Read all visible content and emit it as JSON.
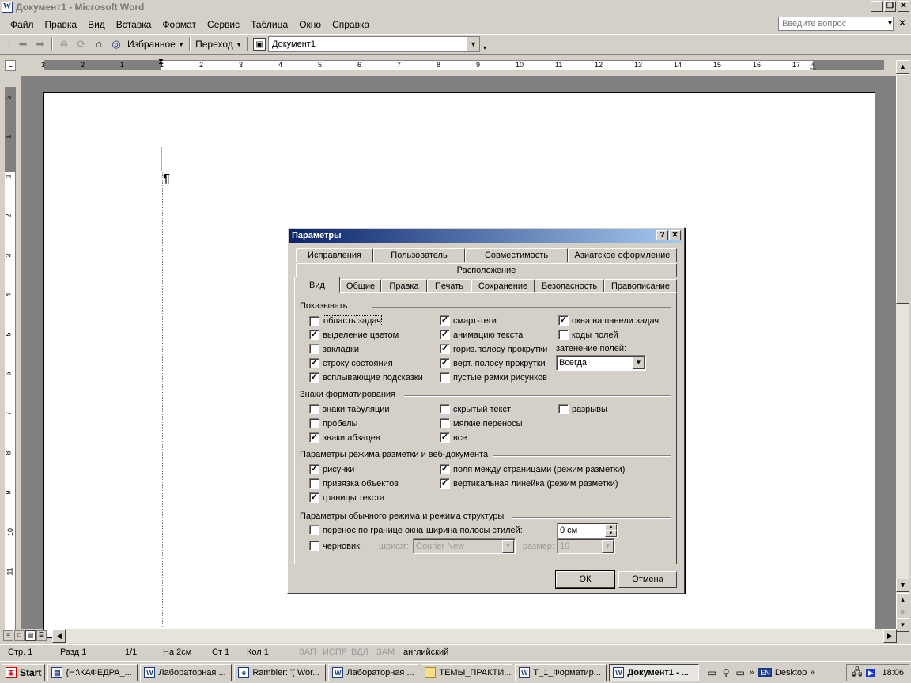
{
  "window": {
    "title": "Документ1 - Microsoft Word",
    "min": "_",
    "restore": "❐",
    "close": "✕"
  },
  "menu": {
    "items": [
      "Файл",
      "Правка",
      "Вид",
      "Вставка",
      "Формат",
      "Сервис",
      "Таблица",
      "Окно",
      "Справка"
    ],
    "ask_placeholder": "Введите вопрос",
    "close": "✕"
  },
  "toolbar": {
    "favorites": "Избранное",
    "go": "Переход",
    "address": "Документ1"
  },
  "ruler": {
    "h_numbers": [
      "3",
      "2",
      "1",
      "1",
      "2",
      "3",
      "4",
      "5",
      "6",
      "7",
      "8",
      "9",
      "10",
      "11",
      "12",
      "13",
      "14",
      "15",
      "16",
      "17"
    ],
    "v_numbers": [
      "2",
      "1",
      "1",
      "2",
      "3",
      "4",
      "5",
      "6",
      "7",
      "8",
      "9",
      "10",
      "11"
    ],
    "corner": "L"
  },
  "document": {
    "paragraph_mark": "¶"
  },
  "status": {
    "page": "Стр. 1",
    "section": "Разд 1",
    "pages": "1/1",
    "at": "На 2см",
    "line": "Ст 1",
    "col": "Кол 1",
    "rec": "ЗАП",
    "trk": "ИСПР",
    "ext": "ВДЛ",
    "ovr": "ЗАМ",
    "lang": "английский"
  },
  "taskbar": {
    "start": "Start",
    "tasks": [
      "{H:\\КАФЕДРА_...",
      "Лабораторная ...",
      "Rambler: '( Wor...",
      "Лабораторная ...",
      "ТЕМЫ_ПРАКТИ...",
      "Т_1_Форматир...",
      "Документ1 - ..."
    ],
    "desktop": "Desktop",
    "clock": "18:06",
    "lang": "EN"
  },
  "dialog": {
    "title": "Параметры",
    "help": "?",
    "close": "✕",
    "tabs_row1": [
      "Исправления",
      "Пользователь",
      "Совместимость",
      "Азиатское оформление"
    ],
    "tabs_row2": [
      "Расположение"
    ],
    "tabs_row3": [
      "Вид",
      "Общие",
      "Правка",
      "Печать",
      "Сохранение",
      "Безопасность",
      "Правописание"
    ],
    "show": {
      "label": "Показывать",
      "col1": [
        {
          "label": "область задач",
          "checked": false
        },
        {
          "label": "выделение цветом",
          "checked": true
        },
        {
          "label": "закладки",
          "checked": false
        },
        {
          "label": "строку состояния",
          "checked": true
        },
        {
          "label": "всплывающие подсказки",
          "checked": true
        }
      ],
      "col2": [
        {
          "label": "смарт-теги",
          "checked": true
        },
        {
          "label": "анимацию текста",
          "checked": true
        },
        {
          "label": "гориз.полосу прокрутки",
          "checked": true
        },
        {
          "label": "верт. полосу прокрутки",
          "checked": true
        },
        {
          "label": "пустые рамки рисунков",
          "checked": false
        }
      ],
      "col3": [
        {
          "label": "окна на панели задач",
          "checked": true
        },
        {
          "label": "коды полей",
          "checked": false
        }
      ],
      "shading_label": "затенение полей:",
      "shading_value": "Всегда"
    },
    "marks": {
      "label": "Знаки форматирования",
      "items": [
        {
          "label": "знаки табуляции",
          "checked": false
        },
        {
          "label": "пробелы",
          "checked": false
        },
        {
          "label": "знаки абзацев",
          "checked": true
        },
        {
          "label": "скрытый текст",
          "checked": false
        },
        {
          "label": "мягкие переносы",
          "checked": false
        },
        {
          "label": "все",
          "checked": true
        },
        {
          "label": "разрывы",
          "checked": false
        }
      ]
    },
    "layout": {
      "label": "Параметры режима разметки и веб-документа",
      "items": [
        {
          "label": "рисунки",
          "checked": true
        },
        {
          "label": "привязка объектов",
          "checked": false
        },
        {
          "label": "границы текста",
          "checked": true
        },
        {
          "label": "поля между страницами (режим разметки)",
          "checked": true
        },
        {
          "label": "вертикальная линейка (режим разметки)",
          "checked": true
        }
      ]
    },
    "normal": {
      "label": "Параметры обычного режима и режима структуры",
      "wrap": {
        "label": "перенос по границе окна",
        "checked": false
      },
      "draft": {
        "label": "черновик:",
        "checked": false
      },
      "style_width_label": "ширина полосы стилей:",
      "style_width_value": "0 см",
      "font_label": "шрифт:",
      "font_value": "Courier New",
      "size_label": "размер:",
      "size_value": "10"
    },
    "ok": "ОК",
    "cancel": "Отмена"
  }
}
